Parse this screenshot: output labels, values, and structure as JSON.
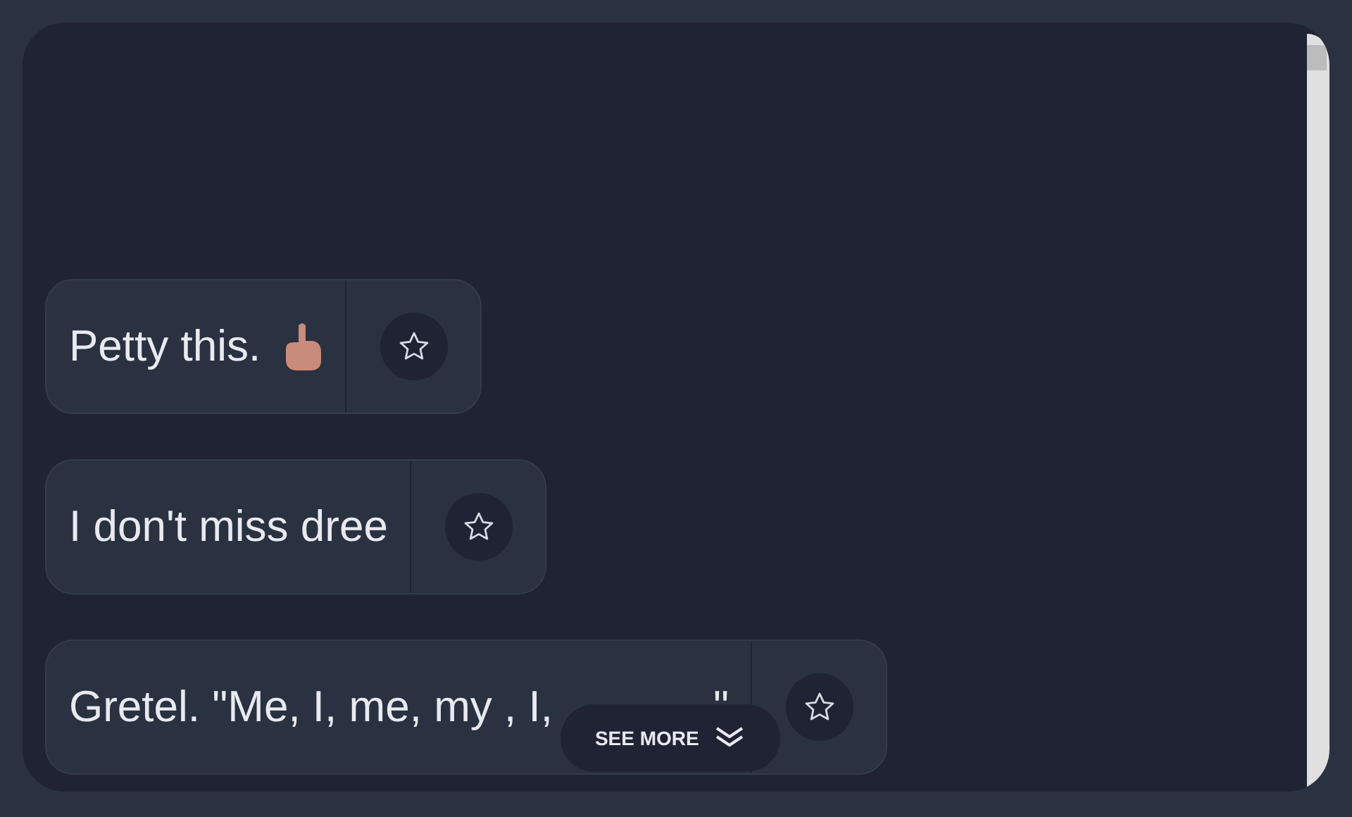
{
  "messages": [
    {
      "text": "Petty this.",
      "kind": "hand"
    },
    {
      "text": "I don't miss dree",
      "kind": "plain"
    },
    {
      "text": "Gretel. \"Me, I, me, my , I,",
      "tail": "\"",
      "kind": "plain"
    }
  ],
  "see_more": {
    "label": "SEE MORE"
  }
}
